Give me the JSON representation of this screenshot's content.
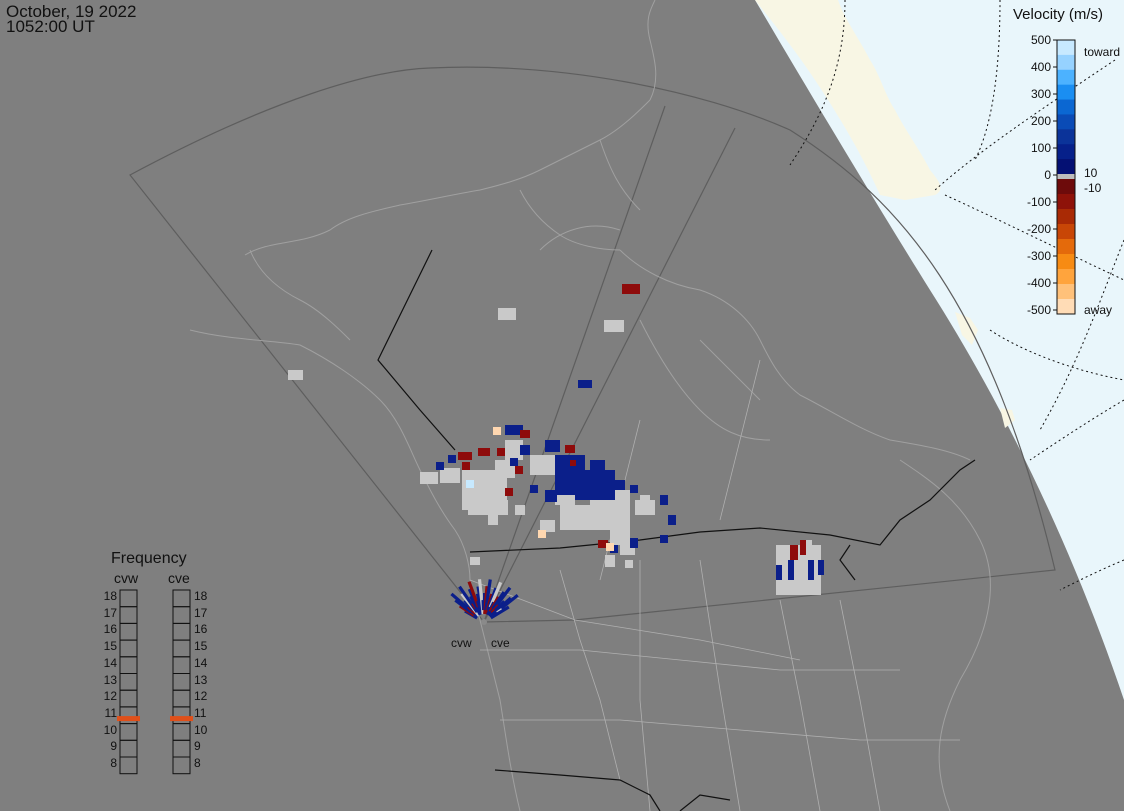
{
  "header": {
    "date": "October, 19 2022",
    "time": "1052:00 UT"
  },
  "colors": {
    "background": "#7f7f7f",
    "arctic_ocean": "#e9f6fb",
    "land_pale": "#f8f6e4",
    "outline": "#9c9c9c",
    "ground_scatter": "#c9c9c9",
    "toward_dark": "#0b1f8a",
    "away_dark": "#8e0b0b"
  },
  "velocity_scale": {
    "title": "Velocity (m/s)",
    "ticks": [
      "500",
      "400",
      "300",
      "200",
      "100",
      "0",
      "-100",
      "-200",
      "-300",
      "-400",
      "-500"
    ],
    "toward_label": "toward",
    "away_label": "away",
    "plus_threshold": "10",
    "minus_threshold": "-10",
    "colors_toward": [
      "#c7e9ff",
      "#96d2ff",
      "#4cb2ff",
      "#1a8ef2",
      "#0b67d2",
      "#0a4bb6",
      "#0b3399",
      "#06208a",
      "#041073"
    ],
    "colors_away": [
      "#6d0b0b",
      "#8e1209",
      "#a92a05",
      "#c84606",
      "#e46a0b",
      "#f78b13",
      "#ffa43d",
      "#ffc17a",
      "#ffdcb6"
    ]
  },
  "frequency_panel": {
    "title": "Frequency",
    "radars": [
      "cvw",
      "cve"
    ],
    "scale": [
      "18",
      "17",
      "16",
      "15",
      "14",
      "13",
      "12",
      "11",
      "10",
      "9",
      "8"
    ],
    "current_mhz": {
      "cvw": 10.8,
      "cve": 10.8
    },
    "marker_color": "#e0501a"
  },
  "radar_labels": [
    "cvw",
    "cve"
  ]
}
